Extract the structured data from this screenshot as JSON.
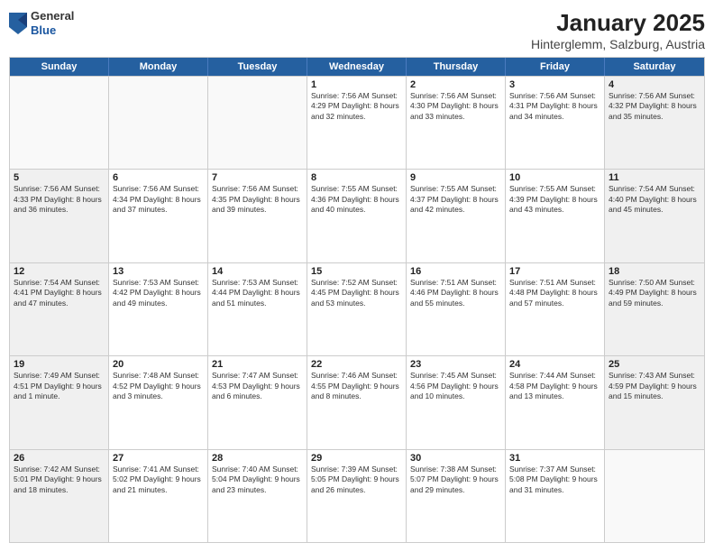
{
  "header": {
    "logo": {
      "general": "General",
      "blue": "Blue"
    },
    "title": "January 2025",
    "subtitle": "Hinterglemm, Salzburg, Austria"
  },
  "calendar": {
    "days_of_week": [
      "Sunday",
      "Monday",
      "Tuesday",
      "Wednesday",
      "Thursday",
      "Friday",
      "Saturday"
    ],
    "weeks": [
      {
        "cells": [
          {
            "day": "",
            "info": ""
          },
          {
            "day": "",
            "info": ""
          },
          {
            "day": "",
            "info": ""
          },
          {
            "day": "1",
            "info": "Sunrise: 7:56 AM\nSunset: 4:29 PM\nDaylight: 8 hours\nand 32 minutes."
          },
          {
            "day": "2",
            "info": "Sunrise: 7:56 AM\nSunset: 4:30 PM\nDaylight: 8 hours\nand 33 minutes."
          },
          {
            "day": "3",
            "info": "Sunrise: 7:56 AM\nSunset: 4:31 PM\nDaylight: 8 hours\nand 34 minutes."
          },
          {
            "day": "4",
            "info": "Sunrise: 7:56 AM\nSunset: 4:32 PM\nDaylight: 8 hours\nand 35 minutes."
          }
        ]
      },
      {
        "cells": [
          {
            "day": "5",
            "info": "Sunrise: 7:56 AM\nSunset: 4:33 PM\nDaylight: 8 hours\nand 36 minutes."
          },
          {
            "day": "6",
            "info": "Sunrise: 7:56 AM\nSunset: 4:34 PM\nDaylight: 8 hours\nand 37 minutes."
          },
          {
            "day": "7",
            "info": "Sunrise: 7:56 AM\nSunset: 4:35 PM\nDaylight: 8 hours\nand 39 minutes."
          },
          {
            "day": "8",
            "info": "Sunrise: 7:55 AM\nSunset: 4:36 PM\nDaylight: 8 hours\nand 40 minutes."
          },
          {
            "day": "9",
            "info": "Sunrise: 7:55 AM\nSunset: 4:37 PM\nDaylight: 8 hours\nand 42 minutes."
          },
          {
            "day": "10",
            "info": "Sunrise: 7:55 AM\nSunset: 4:39 PM\nDaylight: 8 hours\nand 43 minutes."
          },
          {
            "day": "11",
            "info": "Sunrise: 7:54 AM\nSunset: 4:40 PM\nDaylight: 8 hours\nand 45 minutes."
          }
        ]
      },
      {
        "cells": [
          {
            "day": "12",
            "info": "Sunrise: 7:54 AM\nSunset: 4:41 PM\nDaylight: 8 hours\nand 47 minutes."
          },
          {
            "day": "13",
            "info": "Sunrise: 7:53 AM\nSunset: 4:42 PM\nDaylight: 8 hours\nand 49 minutes."
          },
          {
            "day": "14",
            "info": "Sunrise: 7:53 AM\nSunset: 4:44 PM\nDaylight: 8 hours\nand 51 minutes."
          },
          {
            "day": "15",
            "info": "Sunrise: 7:52 AM\nSunset: 4:45 PM\nDaylight: 8 hours\nand 53 minutes."
          },
          {
            "day": "16",
            "info": "Sunrise: 7:51 AM\nSunset: 4:46 PM\nDaylight: 8 hours\nand 55 minutes."
          },
          {
            "day": "17",
            "info": "Sunrise: 7:51 AM\nSunset: 4:48 PM\nDaylight: 8 hours\nand 57 minutes."
          },
          {
            "day": "18",
            "info": "Sunrise: 7:50 AM\nSunset: 4:49 PM\nDaylight: 8 hours\nand 59 minutes."
          }
        ]
      },
      {
        "cells": [
          {
            "day": "19",
            "info": "Sunrise: 7:49 AM\nSunset: 4:51 PM\nDaylight: 9 hours\nand 1 minute."
          },
          {
            "day": "20",
            "info": "Sunrise: 7:48 AM\nSunset: 4:52 PM\nDaylight: 9 hours\nand 3 minutes."
          },
          {
            "day": "21",
            "info": "Sunrise: 7:47 AM\nSunset: 4:53 PM\nDaylight: 9 hours\nand 6 minutes."
          },
          {
            "day": "22",
            "info": "Sunrise: 7:46 AM\nSunset: 4:55 PM\nDaylight: 9 hours\nand 8 minutes."
          },
          {
            "day": "23",
            "info": "Sunrise: 7:45 AM\nSunset: 4:56 PM\nDaylight: 9 hours\nand 10 minutes."
          },
          {
            "day": "24",
            "info": "Sunrise: 7:44 AM\nSunset: 4:58 PM\nDaylight: 9 hours\nand 13 minutes."
          },
          {
            "day": "25",
            "info": "Sunrise: 7:43 AM\nSunset: 4:59 PM\nDaylight: 9 hours\nand 15 minutes."
          }
        ]
      },
      {
        "cells": [
          {
            "day": "26",
            "info": "Sunrise: 7:42 AM\nSunset: 5:01 PM\nDaylight: 9 hours\nand 18 minutes."
          },
          {
            "day": "27",
            "info": "Sunrise: 7:41 AM\nSunset: 5:02 PM\nDaylight: 9 hours\nand 21 minutes."
          },
          {
            "day": "28",
            "info": "Sunrise: 7:40 AM\nSunset: 5:04 PM\nDaylight: 9 hours\nand 23 minutes."
          },
          {
            "day": "29",
            "info": "Sunrise: 7:39 AM\nSunset: 5:05 PM\nDaylight: 9 hours\nand 26 minutes."
          },
          {
            "day": "30",
            "info": "Sunrise: 7:38 AM\nSunset: 5:07 PM\nDaylight: 9 hours\nand 29 minutes."
          },
          {
            "day": "31",
            "info": "Sunrise: 7:37 AM\nSunset: 5:08 PM\nDaylight: 9 hours\nand 31 minutes."
          },
          {
            "day": "",
            "info": ""
          }
        ]
      }
    ]
  }
}
